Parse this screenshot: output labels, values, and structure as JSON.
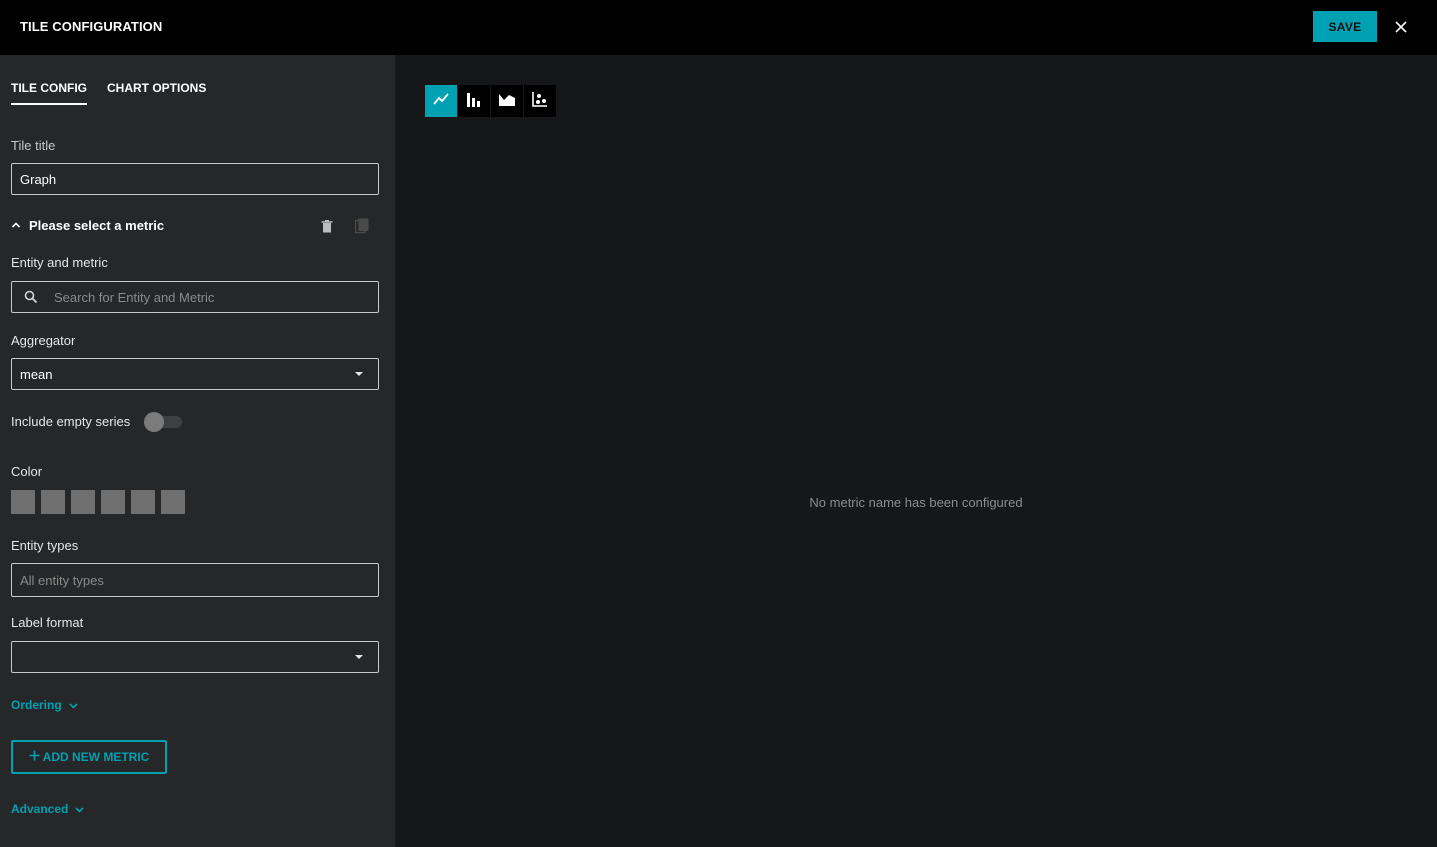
{
  "header": {
    "title": "TILE CONFIGURATION",
    "save_label": "SAVE",
    "close_icon": "close-icon"
  },
  "tabs": [
    {
      "label": "TILE CONFIG",
      "active": true
    },
    {
      "label": "CHART OPTIONS",
      "active": false
    }
  ],
  "form": {
    "tile_title_label": "Tile title",
    "tile_title_value": "Graph",
    "metric_section_title": "Please select a metric",
    "entity_metric_label": "Entity and metric",
    "entity_metric_placeholder": "Search for Entity and Metric",
    "aggregator_label": "Aggregator",
    "aggregator_value": "mean",
    "include_empty_label": "Include empty series",
    "include_empty_on": false,
    "color_label": "Color",
    "color_swatches": [
      "#6f6f6f",
      "#6f6f6f",
      "#6f6f6f",
      "#6f6f6f",
      "#6f6f6f",
      "#6f6f6f"
    ],
    "entity_types_label": "Entity types",
    "entity_types_placeholder": "All entity types",
    "label_format_label": "Label format",
    "label_format_value": "",
    "ordering_label": "Ordering",
    "add_metric_label": "ADD NEW METRIC",
    "advanced_label": "Advanced"
  },
  "chart_types": [
    {
      "icon": "line-chart-icon",
      "active": true
    },
    {
      "icon": "bar-chart-icon",
      "active": false
    },
    {
      "icon": "area-chart-icon",
      "active": false
    },
    {
      "icon": "scatter-chart-icon",
      "active": false
    }
  ],
  "main": {
    "empty_message": "No metric name has been configured"
  },
  "colors": {
    "accent": "#00a1b2",
    "header_bg": "#000000",
    "sidebar_bg": "#262728",
    "main_bg": "#161718"
  }
}
